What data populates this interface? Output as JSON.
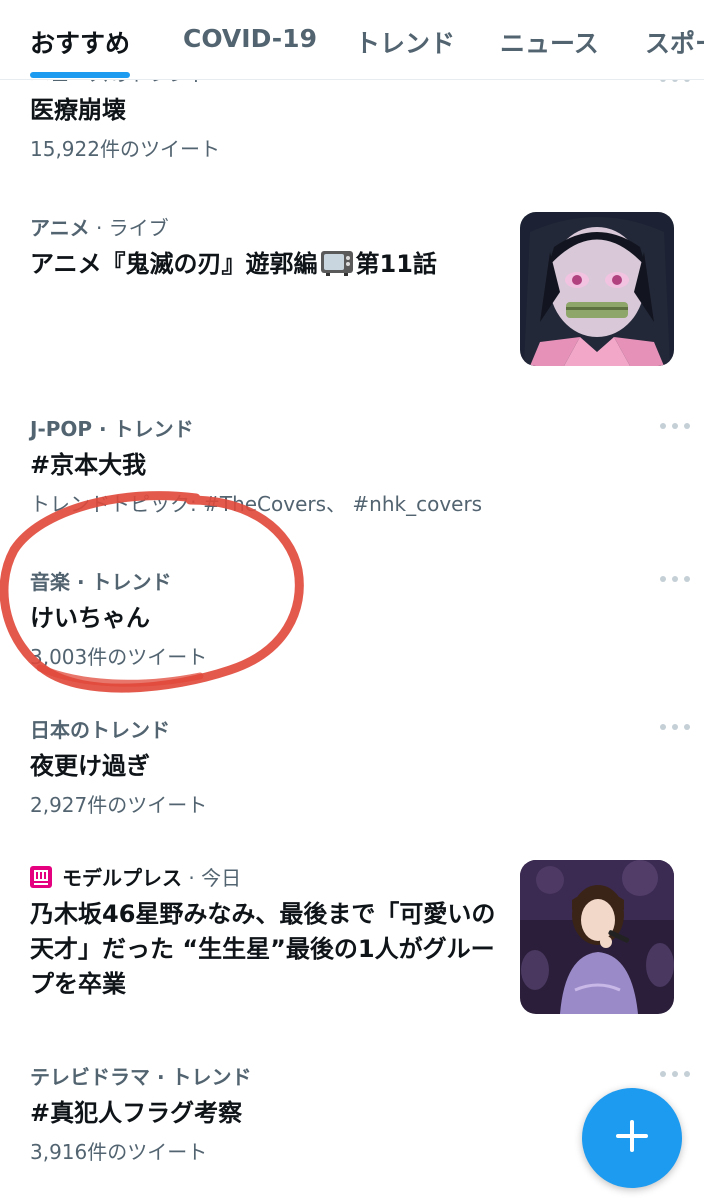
{
  "tabs": [
    {
      "label": "おすすめ"
    },
    {
      "label": "COVID-19"
    },
    {
      "label": "トレンド"
    },
    {
      "label": "ニュース"
    },
    {
      "label": "スポー"
    }
  ],
  "trends": [
    {
      "category": "ニュースのトレンド",
      "title": "医療崩壊",
      "count": "15,922件のツイート"
    },
    {
      "category": "アニメ",
      "context": " · ライブ",
      "title_before": "アニメ『鬼滅の刃』遊郭編",
      "title_after": "第11話",
      "thumbnail": "anime-thumbnail"
    },
    {
      "category": "J-POP · トレンド",
      "title": "#京本大我",
      "topics": "トレンドトピック: #TheCovers、 #nhk_covers"
    },
    {
      "category": "音楽 · トレンド",
      "title": "けいちゃん",
      "count": "3,003件のツイート"
    },
    {
      "category": "日本のトレンド",
      "title": "夜更け過ぎ",
      "count": "2,927件のツイート"
    },
    {
      "category": "モデルプレス",
      "context": " · 今日",
      "title": "乃木坂46星野みなみ、最後まで「可愛いの天才」だった “生生星”最後の1人がグループを卒業",
      "thumbnail": "concert-photo"
    },
    {
      "category": "テレビドラマ · トレンド",
      "title": "#真犯人フラグ考察",
      "count": "3,916件のツイート"
    }
  ],
  "icons": {
    "tv": "television-icon",
    "source_logo": "modelpress-logo-icon",
    "more": "more-icon",
    "compose": "plus-icon"
  },
  "colors": {
    "accent": "#1d9bf0",
    "secondary_text": "#536471",
    "annotation": "#e0483a"
  }
}
